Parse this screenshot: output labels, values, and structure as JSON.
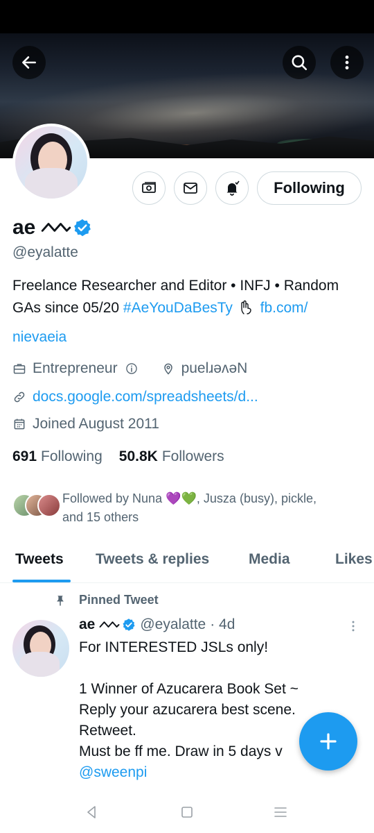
{
  "profile": {
    "name": "ae",
    "handle": "@eyalatte",
    "bio_prefix": "Freelance Researcher and Editor • INFJ • Random GAs since 05/20 ",
    "bio_hashtag": "#AeYouDaBesTy",
    "bio_link_part1": "fb.com/",
    "bio_link_part2": "nievaeia",
    "category": "Entrepreneur",
    "location": "puelɹəʌəN",
    "website": "docs.google.com/spreadsheets/d...",
    "joined": "Joined August 2011",
    "following_count": "691",
    "following_label": "Following",
    "followers_count": "50.8K",
    "followers_label": "Followers",
    "followed_by_prefix": "Followed by Nuna ",
    "followed_by_emoji": "💜💚",
    "followed_by_rest": ", Jusza (busy), pickle,",
    "followed_by_others": "and 15 others"
  },
  "actions": {
    "following_button": "Following"
  },
  "tabs": [
    {
      "label": "Tweets",
      "active": true
    },
    {
      "label": "Tweets & replies",
      "active": false
    },
    {
      "label": "Media",
      "active": false
    },
    {
      "label": "Likes",
      "active": false
    }
  ],
  "tweet": {
    "pinned_label": "Pinned Tweet",
    "author_name": "ae",
    "author_handle": "@eyalatte",
    "time": "· 4d",
    "lines": [
      "For INTERESTED JSLs only!",
      "",
      "1 Winner of Azucarera Book Set ~",
      "Reply your azucarera best scene.",
      "Retweet.",
      "Must be ff me. Draw in 5 days v"
    ],
    "mention": "@sweenpi"
  },
  "colors": {
    "accent": "#1d9bf0",
    "text_primary": "#0f1419",
    "text_secondary": "#536471",
    "border": "#cfd9de"
  },
  "icons": {
    "back": "arrow-left-icon",
    "search": "search-icon",
    "more": "more-vertical-icon",
    "subscribe": "money-icon",
    "message": "envelope-icon",
    "notify": "bell-icon",
    "verified": "verified-badge-icon",
    "fab": "plus-icon"
  }
}
